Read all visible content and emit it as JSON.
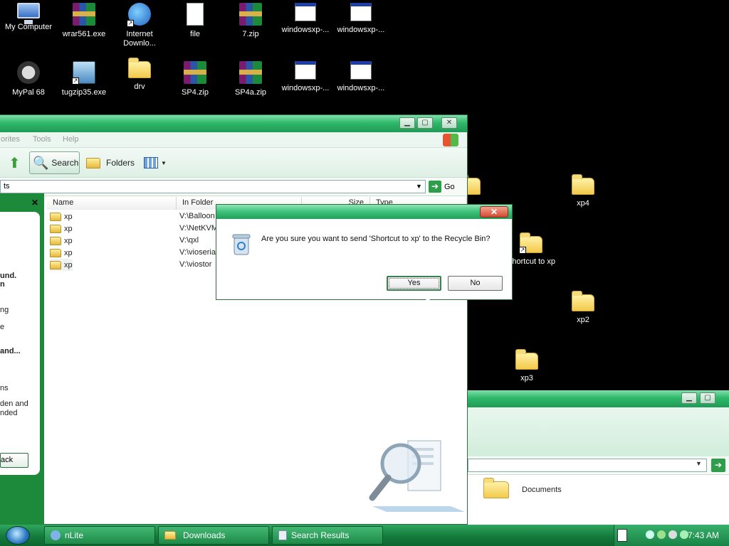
{
  "desktop": {
    "icons": [
      {
        "label": "My Computer",
        "icon": "my-computer-icon"
      },
      {
        "label": "wrar561.exe",
        "icon": "winrar-icon"
      },
      {
        "label": "Internet Downlo...",
        "icon": "internet-download-manager-icon"
      },
      {
        "label": "file",
        "icon": "text-file-icon"
      },
      {
        "label": "7.zip",
        "icon": "winrar-archive-icon"
      },
      {
        "label": "windowsxp-...",
        "icon": "program-window-icon"
      },
      {
        "label": "windowsxp-...",
        "icon": "program-window-icon"
      },
      {
        "label": "MyPal 68",
        "icon": "mypal-browser-icon"
      },
      {
        "label": "tugzip35.exe",
        "icon": "installer-icon"
      },
      {
        "label": "drv",
        "icon": "folder-icon"
      },
      {
        "label": "SP4.zip",
        "icon": "winrar-archive-icon"
      },
      {
        "label": "SP4a.zip",
        "icon": "winrar-archive-icon"
      },
      {
        "label": "windowsxp-...",
        "icon": "program-window-icon"
      },
      {
        "label": "windowsxp-...",
        "icon": "program-window-icon"
      },
      {
        "label": "xp4",
        "icon": "folder-icon"
      },
      {
        "label": "Shortcut to xp",
        "icon": "folder-shortcut-icon"
      },
      {
        "label": "xp2",
        "icon": "folder-icon"
      },
      {
        "label": "xp3",
        "icon": "folder-icon"
      }
    ]
  },
  "search_window": {
    "menu": [
      "orites",
      "Tools",
      "Help"
    ],
    "toolbar": {
      "search_label": "Search",
      "folders_label": "Folders"
    },
    "address": {
      "value": "ts",
      "go_label": "Go"
    },
    "sidepane": {
      "close": "✕",
      "lines": [
        "und.",
        "n",
        "ng",
        "e",
        "and...",
        "ns",
        "den and",
        "nded"
      ],
      "back_label": "ack"
    },
    "columns": [
      "Name",
      "In Folder",
      "Size",
      "Type"
    ],
    "rows": [
      {
        "name": "xp",
        "folder": "V:\\Balloon"
      },
      {
        "name": "xp",
        "folder": "V:\\NetKVM"
      },
      {
        "name": "xp",
        "folder": "V:\\qxl"
      },
      {
        "name": "xp",
        "folder": "V:\\vioserial"
      },
      {
        "name": "xp",
        "folder": "V:\\viostor"
      }
    ]
  },
  "second_window": {
    "item_label": "Documents"
  },
  "dialog": {
    "message": "Are you sure you want to send 'Shortcut to xp' to the Recycle Bin?",
    "yes_label": "Yes",
    "no_label": "No",
    "close": "✕"
  },
  "taskbar": {
    "tasks": [
      {
        "label": "nLite"
      },
      {
        "label": "Downloads"
      },
      {
        "label": "Search Results"
      }
    ],
    "clock": "7:43 AM"
  },
  "colors": {
    "accent": "#1f9a55",
    "taskbar": "#137b3c",
    "desktop": "#000000"
  }
}
